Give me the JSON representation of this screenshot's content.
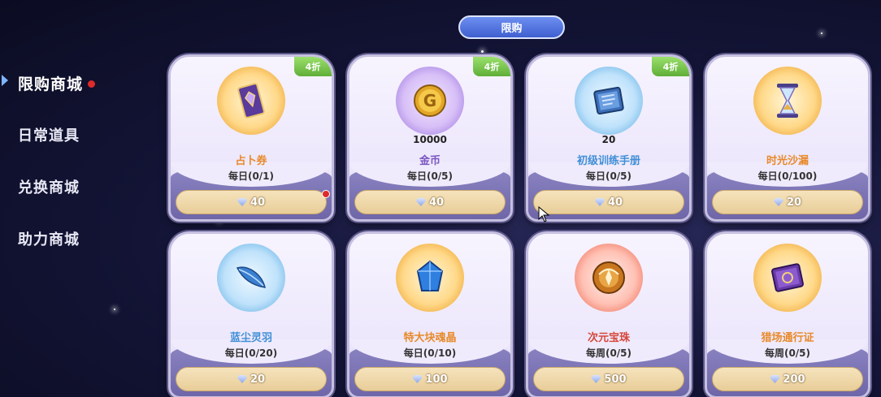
{
  "top_tab": {
    "label": "限购"
  },
  "sidebar": {
    "items": [
      {
        "label": "限购商城",
        "active": true,
        "badge": true
      },
      {
        "label": "日常道具",
        "active": false,
        "badge": false
      },
      {
        "label": "兑换商城",
        "active": false,
        "badge": false
      },
      {
        "label": "助力商城",
        "active": false,
        "badge": false
      }
    ]
  },
  "items": [
    {
      "name": "占卜券",
      "quantity": "",
      "limit": "每日(0/1)",
      "price": "40",
      "discount": "4折",
      "icon": "purple-card-icon",
      "glow": "gold",
      "name_color": "orange"
    },
    {
      "name": "金币",
      "quantity": "10000",
      "limit": "每日(0/5)",
      "price": "40",
      "discount": "4折",
      "icon": "gold-coin-icon",
      "glow": "purple",
      "name_color": "purple"
    },
    {
      "name": "初级训练手册",
      "quantity": "20",
      "limit": "每日(0/5)",
      "price": "40",
      "discount": "4折",
      "icon": "blue-book-icon",
      "glow": "blue",
      "name_color": "blue"
    },
    {
      "name": "时光沙漏",
      "quantity": "",
      "limit": "每日(0/100)",
      "price": "20",
      "discount": "",
      "icon": "hourglass-icon",
      "glow": "gold",
      "name_color": "orange"
    },
    {
      "name": "蓝尘灵羽",
      "quantity": "",
      "limit": "每日(0/20)",
      "price": "20",
      "discount": "",
      "icon": "blue-feather-icon",
      "glow": "blue",
      "name_color": "blue"
    },
    {
      "name": "特大块魂晶",
      "quantity": "",
      "limit": "每日(0/10)",
      "price": "100",
      "discount": "",
      "icon": "blue-crystal-icon",
      "glow": "gold",
      "name_color": "orange"
    },
    {
      "name": "次元宝珠",
      "quantity": "",
      "limit": "每周(0/5)",
      "price": "500",
      "discount": "",
      "icon": "orb-icon",
      "glow": "red",
      "name_color": "red"
    },
    {
      "name": "猎场通行证",
      "quantity": "",
      "limit": "每周(0/5)",
      "price": "200",
      "discount": "",
      "icon": "purple-pass-icon",
      "glow": "gold",
      "name_color": "orange"
    }
  ]
}
